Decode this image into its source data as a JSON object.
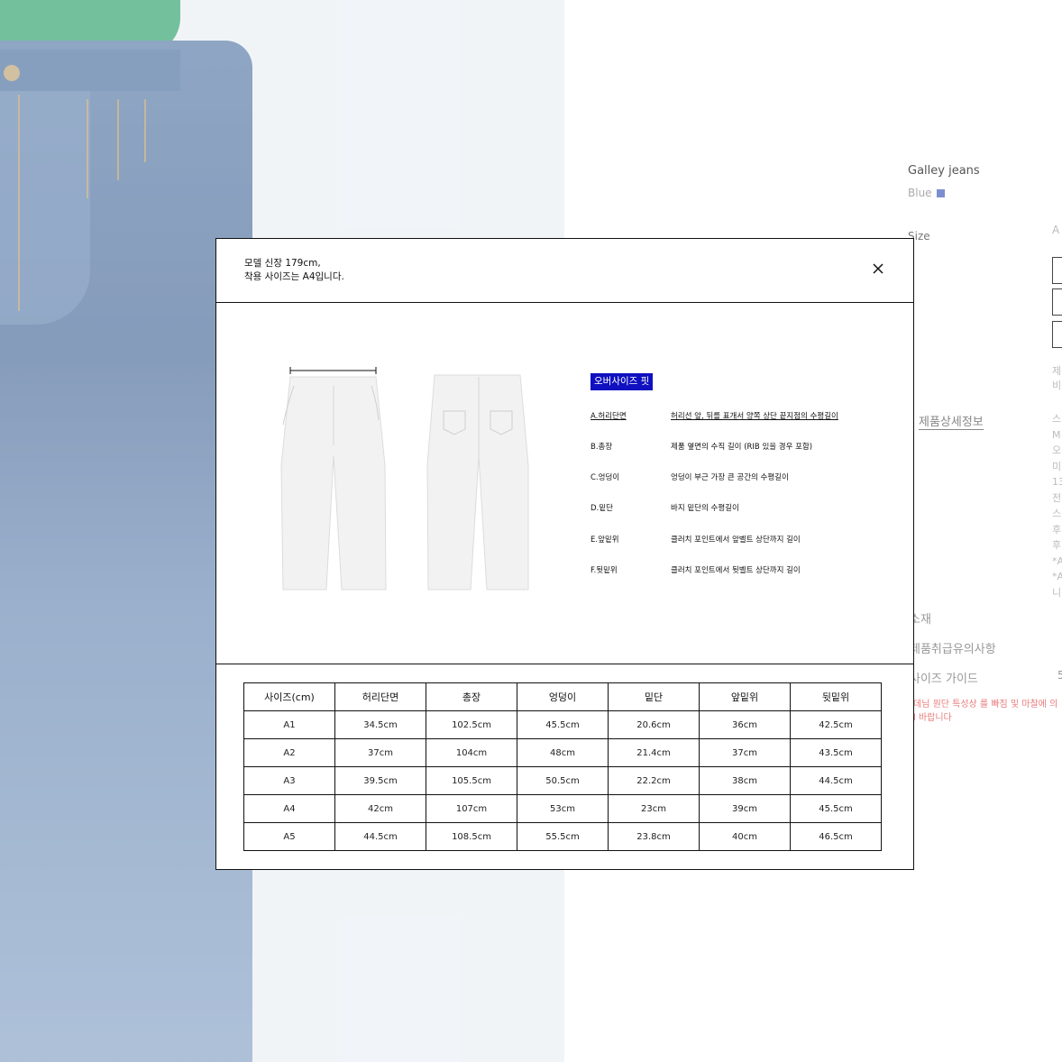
{
  "product": {
    "name": "Galley jeans",
    "color": "Blue",
    "color_swatch": "#7b8ed0",
    "size_label": "Size",
    "size_first_option_partial": "A",
    "side_text_lines_a": [
      "제",
      "비"
    ],
    "side_text_lines_b": [
      "스",
      "M",
      "오",
      "미",
      "13",
      "전",
      "스",
      "후",
      "후",
      "*A",
      "*A",
      "니"
    ],
    "detail_link": "제품상세정보",
    "menu": [
      "소재",
      "제품취급유의사항",
      "사이즈 가이드"
    ],
    "menu_arrow": "5",
    "notice_lines": [
      "데님 원단 특성상 를 빠짐 및 마찰에 의",
      "l 바랍니다"
    ]
  },
  "modal": {
    "model_info_line1": "모델 신장 179cm,",
    "model_info_line2": "착용 사이즈는 A4입니다.",
    "close_icon": "close-icon",
    "fit_badge": "오버사이즈 핏",
    "measurements": [
      {
        "label": "A.허리단면",
        "desc": "허리선 앞, 뒤를 표개서 양쪽 상단 끝지점의 수평길이"
      },
      {
        "label": "B.총장",
        "desc": "제품 옆면의 수직 길이 (RIB 있을 경우 포함)"
      },
      {
        "label": "C.엉덩이",
        "desc": "엉덩이 부근 가장 큰 공간의 수평길이"
      },
      {
        "label": "D.밑단",
        "desc": "바지 밑단의 수평길이"
      },
      {
        "label": "E.앞밑위",
        "desc": "클러치 포인트에서 앞벨트 상단까지 길이"
      },
      {
        "label": "F.뒷밑위",
        "desc": "클러치 포인트에서 뒷벨트 상단까지 길이"
      }
    ],
    "table": {
      "headers": [
        "사이즈(cm)",
        "허리단면",
        "총장",
        "엉덩이",
        "밑단",
        "앞밑위",
        "뒷밑위"
      ],
      "rows": [
        [
          "A1",
          "34.5cm",
          "102.5cm",
          "45.5cm",
          "20.6cm",
          "36cm",
          "42.5cm"
        ],
        [
          "A2",
          "37cm",
          "104cm",
          "48cm",
          "21.4cm",
          "37cm",
          "43.5cm"
        ],
        [
          "A3",
          "39.5cm",
          "105.5cm",
          "50.5cm",
          "22.2cm",
          "38cm",
          "44.5cm"
        ],
        [
          "A4",
          "42cm",
          "107cm",
          "53cm",
          "23cm",
          "39cm",
          "45.5cm"
        ],
        [
          "A5",
          "44.5cm",
          "108.5cm",
          "55.5cm",
          "23.8cm",
          "40cm",
          "46.5cm"
        ]
      ]
    }
  }
}
